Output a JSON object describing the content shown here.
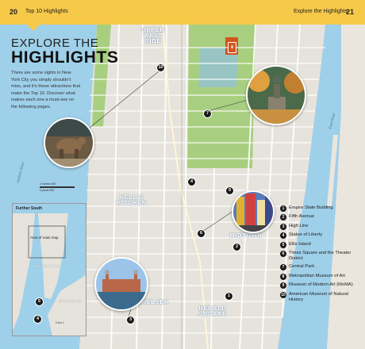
{
  "header": {
    "left_page_number": "20",
    "left_label": "Top 10 Highlights",
    "right_label": "Explore the Highlights",
    "right_page_number": "21"
  },
  "title": {
    "small": "EXPLORE THE",
    "big": "HIGHLIGHTS"
  },
  "intro_text": "There are some sights in New York City you simply shouldn't miss, and it's these attractions that make the Top 10. Discover what makes each one a must-see on the following pages.",
  "map_labels": {
    "upper_west_side": "UPPER WEST SIDE",
    "hells_kitchen": "HELL'S KITCHEN",
    "midtown": "MIDTOWN",
    "chelsea": "CHELSEA",
    "herald_square": "HERALD SQUARE",
    "hudson_river": "Hudson River",
    "east_river": "East River"
  },
  "scale": {
    "km": "0 meters   500",
    "miles": "0 yards   500"
  },
  "inset": {
    "title": "Further South",
    "area_of_main_map": "Area of main map",
    "manhattan": "MANHATTAN",
    "brooklyn": "BROOKLYN",
    "scale": "0 km   1"
  },
  "markers": [
    {
      "num": "1"
    },
    {
      "num": "2"
    },
    {
      "num": "3"
    },
    {
      "num": "4"
    },
    {
      "num": "5"
    },
    {
      "num": "6"
    },
    {
      "num": "7"
    },
    {
      "num": "8"
    },
    {
      "num": "9"
    },
    {
      "num": "10"
    }
  ],
  "legend": [
    {
      "num": "1",
      "text": "Empire State Building"
    },
    {
      "num": "2",
      "text": "Fifth Avenue"
    },
    {
      "num": "3",
      "text": "High Line"
    },
    {
      "num": "4",
      "text": "Statue of Liberty"
    },
    {
      "num": "5",
      "text": "Ellis Island"
    },
    {
      "num": "6",
      "text": "Times Square and the Theater District"
    },
    {
      "num": "7",
      "text": "Central Park"
    },
    {
      "num": "8",
      "text": "Metropolitan Museum of Art"
    },
    {
      "num": "9",
      "text": "Museum of Modern Art (MoMA)"
    },
    {
      "num": "10",
      "text": "American Museum of Natural History"
    }
  ],
  "colors": {
    "accent": "#f7c948",
    "water": "#9fd0ea",
    "park": "#a8cf7f",
    "marker": "#1a1a1a"
  }
}
